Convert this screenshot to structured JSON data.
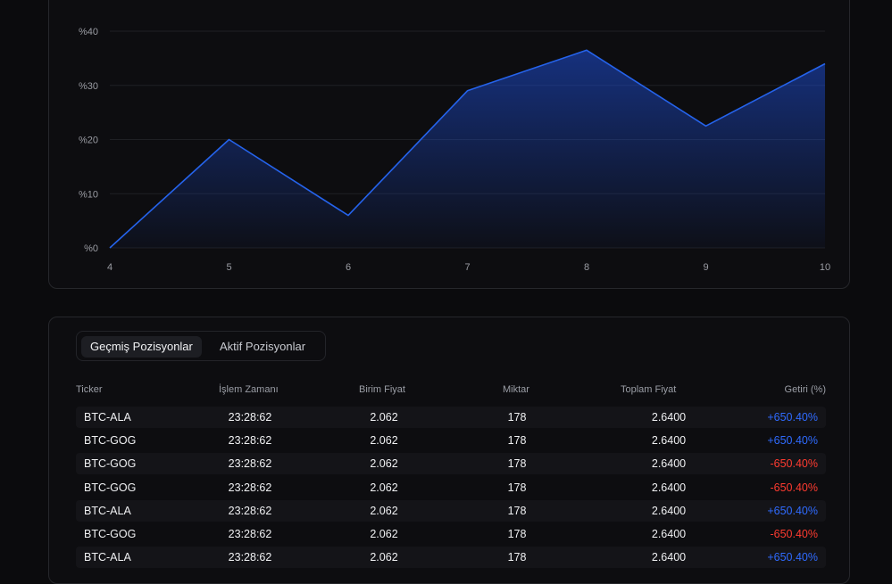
{
  "chart": {
    "y_ticks": [
      "%40",
      "%30",
      "%20",
      "%10",
      "%0"
    ],
    "x_ticks": [
      "4",
      "5",
      "6",
      "7",
      "8",
      "9",
      "10"
    ]
  },
  "chart_data": {
    "type": "area",
    "x": [
      4,
      5,
      6,
      7,
      8,
      9,
      10
    ],
    "y": [
      0,
      20,
      6,
      29,
      36.5,
      22.5,
      34
    ],
    "ylim": [
      0,
      40
    ],
    "xlim": [
      4,
      10
    ],
    "grid": true,
    "colors": {
      "line": "#2563eb",
      "fill_top": "#1d4ed8",
      "grid": "#1f2024"
    }
  },
  "table": {
    "tabs": [
      "Geçmiş Pozisyonlar",
      "Aktif Pozisyonlar"
    ],
    "active_tab": "Geçmiş Pozisyonlar",
    "columns": [
      "Ticker",
      "İşlem Zamanı",
      "Birim Fiyat",
      "Miktar",
      "Toplam Fiyat",
      "Getiri (%)"
    ],
    "rows": [
      {
        "ticker": "BTC-ALA",
        "time": "23:28:62",
        "price": "2.062",
        "qty": "178",
        "total": "2.6400",
        "ret": "+650.40%",
        "dir": "pos"
      },
      {
        "ticker": "BTC-GOG",
        "time": "23:28:62",
        "price": "2.062",
        "qty": "178",
        "total": "2.6400",
        "ret": "+650.40%",
        "dir": "pos"
      },
      {
        "ticker": "BTC-GOG",
        "time": "23:28:62",
        "price": "2.062",
        "qty": "178",
        "total": "2.6400",
        "ret": "-650.40%",
        "dir": "neg"
      },
      {
        "ticker": "BTC-GOG",
        "time": "23:28:62",
        "price": "2.062",
        "qty": "178",
        "total": "2.6400",
        "ret": "-650.40%",
        "dir": "neg"
      },
      {
        "ticker": "BTC-ALA",
        "time": "23:28:62",
        "price": "2.062",
        "qty": "178",
        "total": "2.6400",
        "ret": "+650.40%",
        "dir": "pos"
      },
      {
        "ticker": "BTC-GOG",
        "time": "23:28:62",
        "price": "2.062",
        "qty": "178",
        "total": "2.6400",
        "ret": "-650.40%",
        "dir": "neg"
      },
      {
        "ticker": "BTC-ALA",
        "time": "23:28:62",
        "price": "2.062",
        "qty": "178",
        "total": "2.6400",
        "ret": "+650.40%",
        "dir": "pos"
      }
    ]
  }
}
